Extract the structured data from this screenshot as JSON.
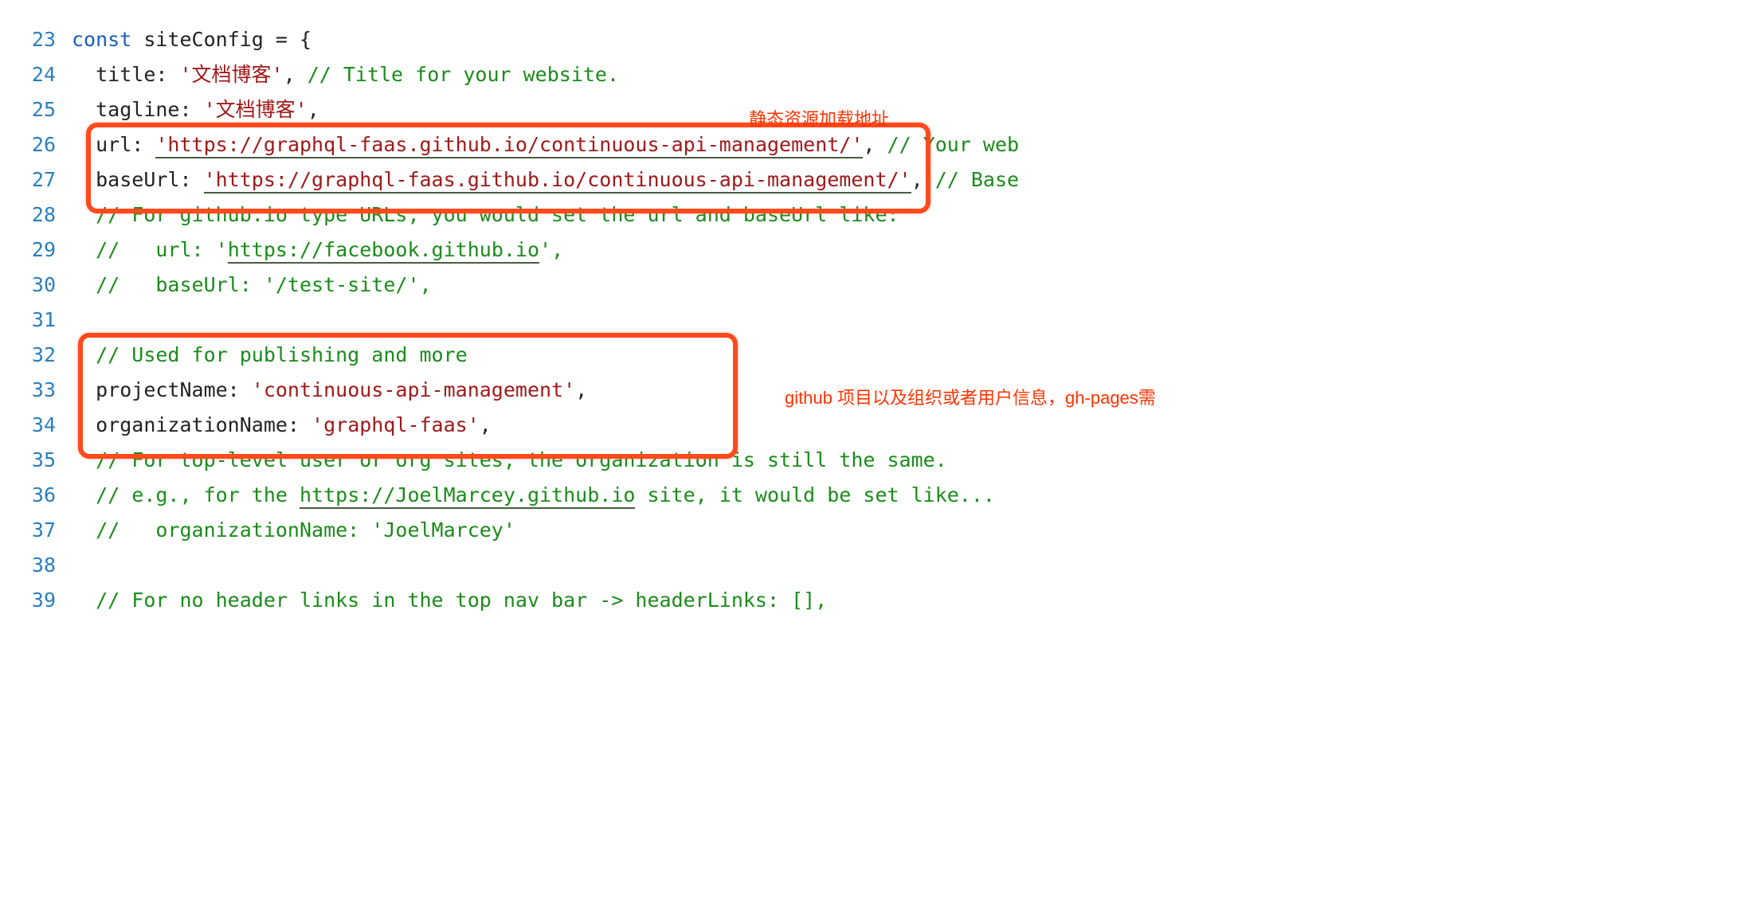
{
  "gutter": {
    "start": 23,
    "end": 39
  },
  "annotations": {
    "top_right": "静态资源加载地址",
    "mid_right": "github 项目以及组织或者用户信息，gh-pages需"
  },
  "code": {
    "l23": {
      "kw": "const",
      "name": " siteConfig = {"
    },
    "l24": {
      "indent": "  ",
      "prop": "title: ",
      "str": "'文档博客'",
      "post": ", ",
      "cmt": "// Title for your website."
    },
    "l25": {
      "indent": "  ",
      "prop": "tagline: ",
      "str": "'文档博客'",
      "post": ","
    },
    "l26": {
      "indent": "  ",
      "prop": "url: ",
      "str": "'https://graphql-faas.github.io/continuous-api-management/'",
      "post": ", ",
      "cmt": "// Your web"
    },
    "l27": {
      "indent": "  ",
      "prop": "baseUrl: ",
      "str": "'https://graphql-faas.github.io/continuous-api-management/'",
      "post": ", ",
      "cmt": "// Base"
    },
    "l28": {
      "indent": "  ",
      "cmt": "// For github.io type URLs, you would set the url and baseUrl like:"
    },
    "l29": {
      "indent": "  ",
      "cmt_pre": "//   url: '",
      "cmt_url": "https://facebook.github.io",
      "cmt_post": "',"
    },
    "l30": {
      "indent": "  ",
      "cmt": "//   baseUrl: '/test-site/',"
    },
    "l31": {
      "indent": ""
    },
    "l32": {
      "indent": "  ",
      "cmt": "// Used for publishing and more"
    },
    "l33": {
      "indent": "  ",
      "prop": "projectName: ",
      "str": "'continuous-api-management'",
      "post": ","
    },
    "l34": {
      "indent": "  ",
      "prop": "organizationName: ",
      "str": "'graphql-faas'",
      "post": ","
    },
    "l35": {
      "indent": "  ",
      "cmt": "// For top-level user or org sites, the organization is still the same."
    },
    "l36": {
      "indent": "  ",
      "cmt_pre": "// e.g., for the ",
      "cmt_url": "https://JoelMarcey.github.io",
      "cmt_post": " site, it would be set like..."
    },
    "l37": {
      "indent": "  ",
      "cmt": "//   organizationName: 'JoelMarcey'"
    },
    "l38": {
      "indent": ""
    },
    "l39": {
      "indent": "  ",
      "cmt": "// For no header links in the top nav bar -> headerLinks: [],"
    }
  }
}
